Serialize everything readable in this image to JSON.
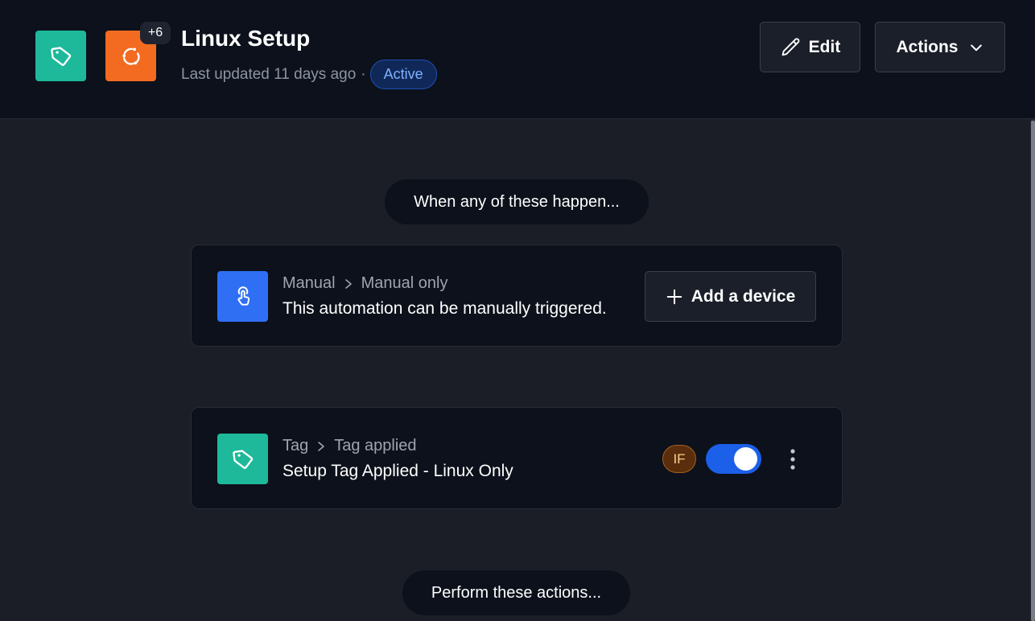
{
  "header": {
    "title": "Linux Setup",
    "updated": "Last updated 11 days ago",
    "separator": "·",
    "status": "Active",
    "more_count": "+6",
    "edit_label": "Edit",
    "actions_label": "Actions",
    "icons": [
      "tag-icon",
      "sync-icon",
      "pencil-icon",
      "chevron-down-icon"
    ]
  },
  "flow": {
    "when_label": "When any of these happen...",
    "perform_label": "Perform these actions..."
  },
  "trigger": {
    "icon": "hand-pointer-icon",
    "category": "Manual",
    "name": "Manual only",
    "description": "This automation can be manually triggered.",
    "add_label": "Add a device"
  },
  "condition": {
    "icon": "tag-icon",
    "category": "Tag",
    "name": "Tag applied",
    "description": "Setup Tag Applied - Linux Only",
    "if_label": "IF",
    "enabled": true
  },
  "colors": {
    "header_bg": "#0c111b",
    "canvas_bg": "#1b1e26",
    "teal": "#1db99a",
    "orange": "#f26b21",
    "blue": "#2f6ff4",
    "toggle_on": "#1c5fe8",
    "badge_active_text": "#7fb0ff"
  }
}
